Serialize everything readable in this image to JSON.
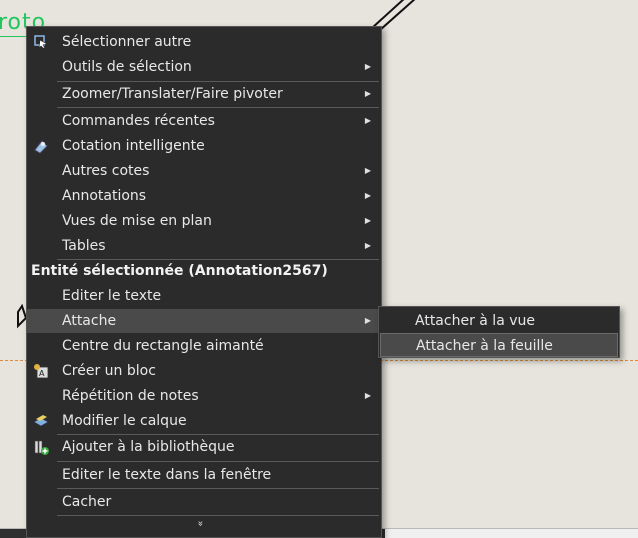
{
  "background": {
    "green_annotation_text": "roto"
  },
  "menu": {
    "items": [
      {
        "label": "Sélectionner autre",
        "icon": "select-other-icon",
        "submenu": false
      },
      {
        "label": "Outils de sélection",
        "submenu": true
      },
      {
        "label": "Zoomer/Translater/Faire pivoter",
        "submenu": true
      },
      {
        "label": "Commandes récentes",
        "submenu": true
      },
      {
        "label": "Cotation intelligente",
        "icon": "smart-dimension-icon",
        "submenu": false
      },
      {
        "label": "Autres cotes",
        "submenu": true
      },
      {
        "label": "Annotations",
        "submenu": true
      },
      {
        "label": "Vues de mise en plan",
        "submenu": true
      },
      {
        "label": "Tables",
        "submenu": true
      }
    ],
    "section_header": "Entité sélectionnée (Annotation2567)",
    "section_items": [
      {
        "label": "Editer le texte",
        "submenu": false
      },
      {
        "label": "Attache",
        "submenu": true,
        "highlighted": true
      },
      {
        "label": "Centre du rectangle aimanté",
        "submenu": false
      },
      {
        "label": "Créer un bloc",
        "icon": "create-block-icon",
        "submenu": false
      },
      {
        "label": "Répétition de notes",
        "submenu": true
      },
      {
        "label": "Modifier le calque",
        "icon": "layer-icon",
        "submenu": false
      },
      {
        "label": "Ajouter à la bibliothèque",
        "icon": "add-library-icon",
        "submenu": false
      },
      {
        "label": "Editer le texte dans la fenêtre",
        "submenu": false
      },
      {
        "label": "Cacher",
        "submenu": false
      }
    ],
    "more_glyph": "»"
  },
  "submenu": {
    "items": [
      {
        "label": "Attacher à la vue",
        "highlighted": false
      },
      {
        "label": "Attacher à la feuille",
        "highlighted": true
      }
    ]
  }
}
